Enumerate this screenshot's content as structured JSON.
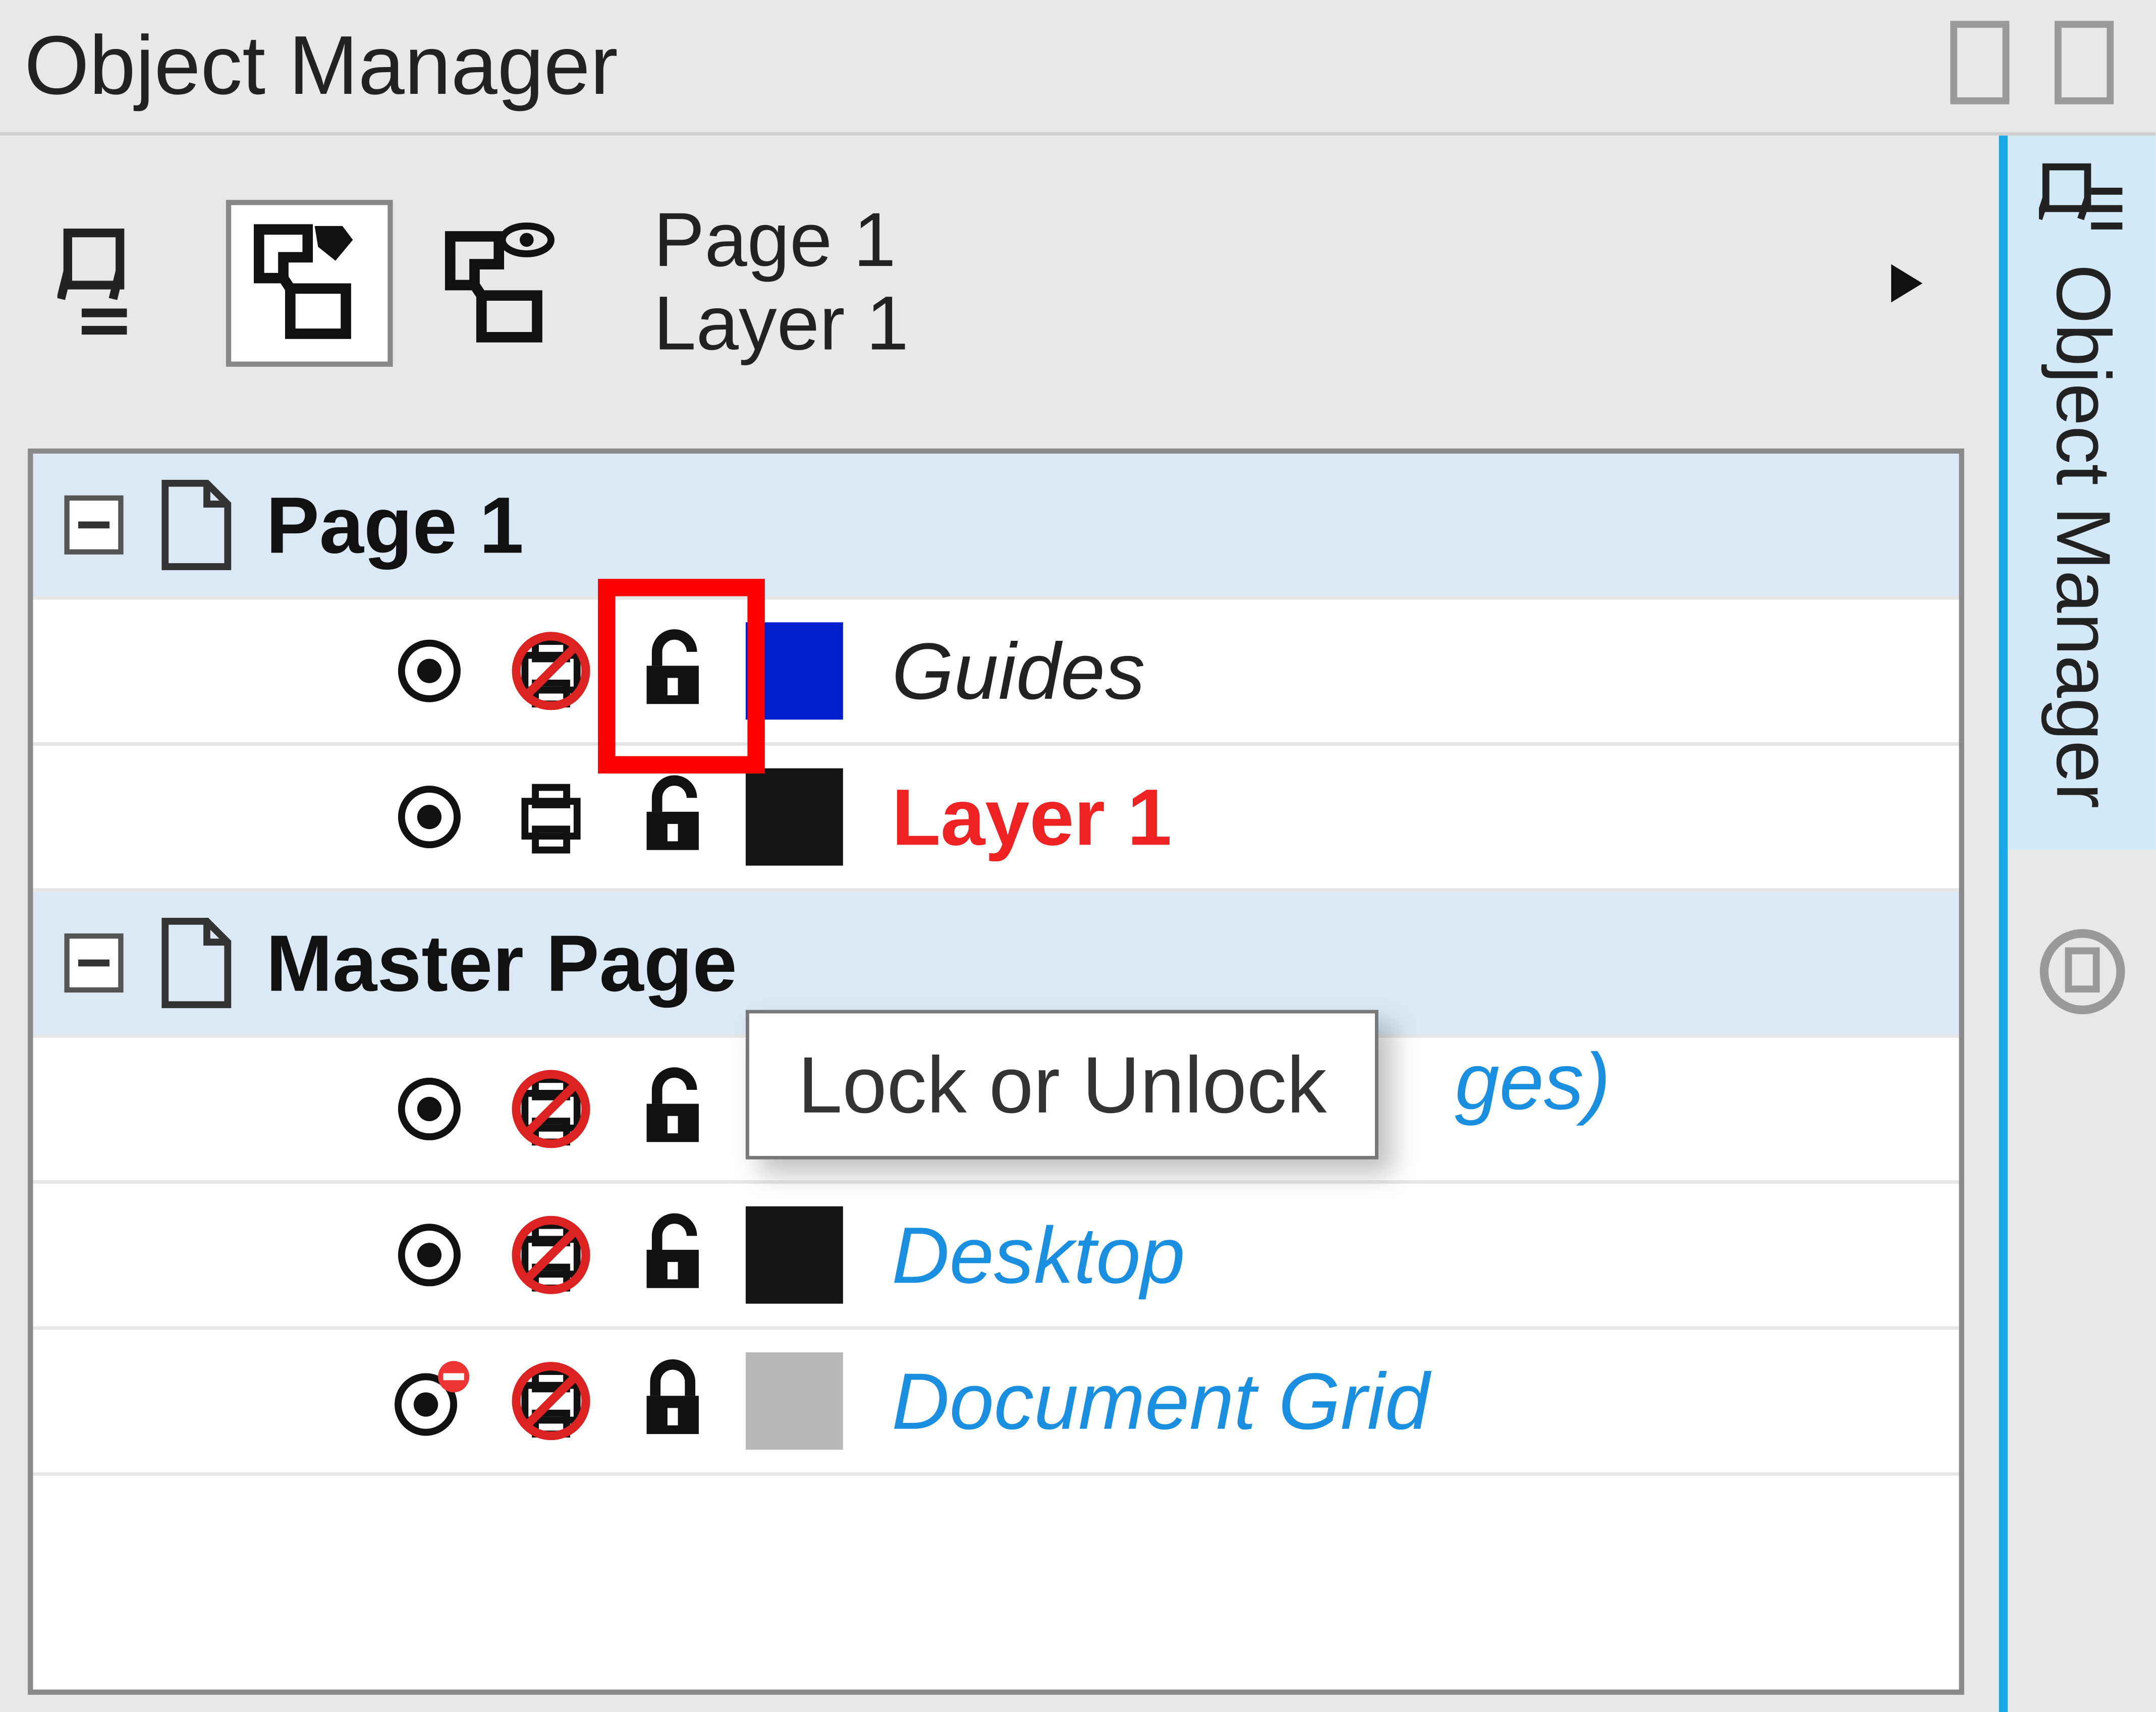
{
  "title": "Object Manager",
  "side_tab_label": "Object Manager",
  "toolbar": {
    "page_label": "Page 1",
    "layer_label": "Layer 1"
  },
  "tooltip": "Lock or Unlock",
  "groups": [
    {
      "name": "Page 1",
      "layers": [
        {
          "label": "Guides",
          "swatch": "#0020d0",
          "style": "italic black",
          "print_disabled": true,
          "locked": false,
          "vis_disabled": false
        },
        {
          "label": "Layer 1",
          "swatch": "#141414",
          "style": "red",
          "print_disabled": false,
          "locked": false,
          "vis_disabled": false,
          "highlighted": true
        }
      ]
    },
    {
      "name": "Master Page",
      "layers": [
        {
          "label": "ges)",
          "trail_only": true,
          "swatch": "#0020d0",
          "style": "italic blue",
          "print_disabled": true,
          "locked": false,
          "vis_disabled": false
        },
        {
          "label": "Desktop",
          "swatch": "#141414",
          "style": "italic blue",
          "print_disabled": true,
          "locked": false,
          "vis_disabled": false
        },
        {
          "label": "Document Grid",
          "swatch": "#b8b8b8",
          "style": "italic blue",
          "print_disabled": true,
          "locked": true,
          "vis_disabled": true
        }
      ]
    }
  ]
}
